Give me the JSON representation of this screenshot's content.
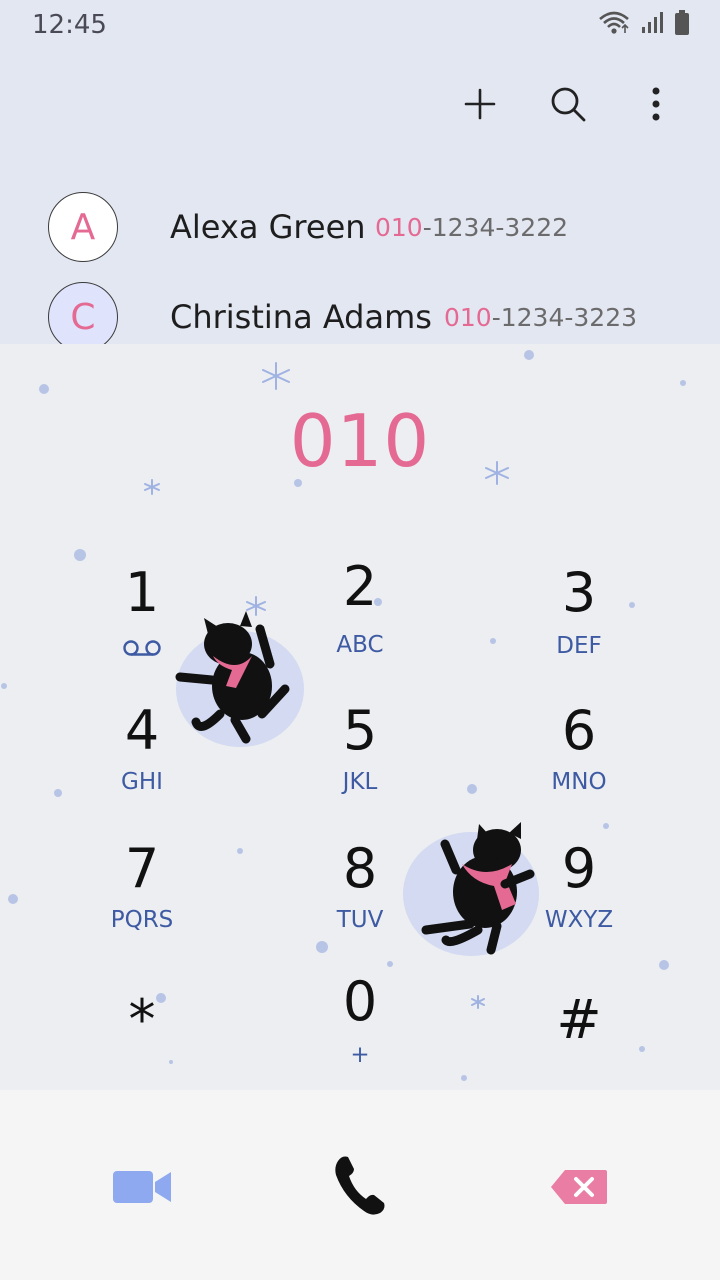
{
  "status_bar": {
    "time": "12:45"
  },
  "contacts": [
    {
      "initial": "A",
      "name": "Alexa Green",
      "number_highlight": "010",
      "number_rest": "-1234-3222"
    },
    {
      "initial": "C",
      "name": "Christina Adams",
      "number_highlight": "010",
      "number_rest": "-1234-3223"
    }
  ],
  "dialer": {
    "display": "010"
  },
  "keys": [
    {
      "digit": "1",
      "letters": ""
    },
    {
      "digit": "2",
      "letters": "ABC"
    },
    {
      "digit": "3",
      "letters": "DEF"
    },
    {
      "digit": "4",
      "letters": "GHI"
    },
    {
      "digit": "5",
      "letters": "JKL"
    },
    {
      "digit": "6",
      "letters": "MNO"
    },
    {
      "digit": "7",
      "letters": "PQRS"
    },
    {
      "digit": "8",
      "letters": "TUV"
    },
    {
      "digit": "9",
      "letters": "WXYZ"
    },
    {
      "digit": "*",
      "letters": ""
    },
    {
      "digit": "0",
      "letters": "+"
    },
    {
      "digit": "#",
      "letters": ""
    }
  ],
  "icons": {
    "add": "plus-icon",
    "search": "search-icon",
    "more": "more-vertical-icon",
    "voicemail": "voicemail-icon",
    "video_call": "video-camera-icon",
    "call": "phone-icon",
    "backspace": "backspace-icon"
  },
  "colors": {
    "accent_pink": "#e46a93",
    "letters_blue": "#3d5aa3",
    "video_blue": "#8ea9ef",
    "contacts_bg": "#e3e7f2"
  }
}
